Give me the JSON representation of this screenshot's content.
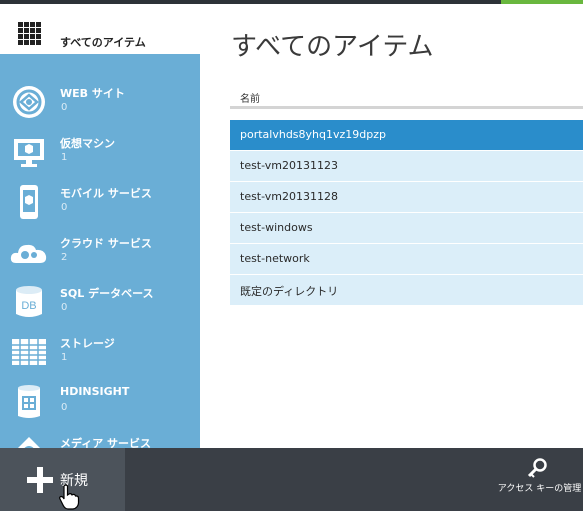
{
  "sidebar": {
    "items": [
      {
        "label": "すべてのアイテム",
        "count": "",
        "icon": "grid-icon"
      },
      {
        "label": "WEB サイト",
        "count": "0",
        "icon": "globe-icon"
      },
      {
        "label": "仮想マシン",
        "count": "1",
        "icon": "monitor-icon"
      },
      {
        "label": "モバイル サービス",
        "count": "0",
        "icon": "mobile-icon"
      },
      {
        "label": "クラウド サービス",
        "count": "2",
        "icon": "cloud-gears-icon"
      },
      {
        "label": "SQL データベース",
        "count": "0",
        "icon": "database-icon"
      },
      {
        "label": "ストレージ",
        "count": "1",
        "icon": "table-icon"
      },
      {
        "label": "HDINSIGHT",
        "count": "0",
        "icon": "hdinsight-icon"
      },
      {
        "label": "メディア サービス",
        "count": "",
        "icon": "media-icon"
      }
    ]
  },
  "main": {
    "title": "すべてのアイテム",
    "column_header": "名前",
    "rows": [
      {
        "name": "portalvhds8yhq1vz19dpzp",
        "selected": true
      },
      {
        "name": "test-vm20131123",
        "selected": false
      },
      {
        "name": "test-vm20131128",
        "selected": false
      },
      {
        "name": "test-windows",
        "selected": false
      },
      {
        "name": "test-network",
        "selected": false
      },
      {
        "name": "既定のディレクトリ",
        "selected": false
      }
    ]
  },
  "bottombar": {
    "new_label": "新規",
    "access_key_label": "アクセス キーの管理"
  },
  "colors": {
    "sidebar": "#6aaed6",
    "selected_row": "#2a8dcb",
    "row": "#dbeef9",
    "bottombar": "#3a3f46",
    "accent_green": "#69b73e"
  }
}
